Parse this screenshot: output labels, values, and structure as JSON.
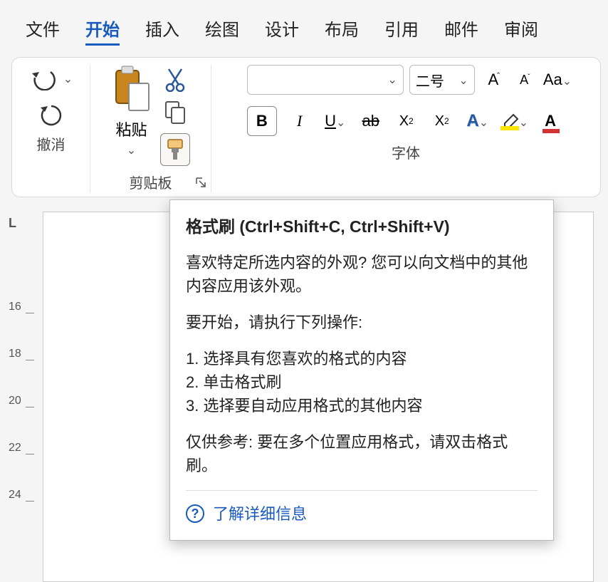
{
  "tabs": {
    "file": "文件",
    "home": "开始",
    "insert": "插入",
    "draw": "绘图",
    "design": "设计",
    "layout": "布局",
    "references": "引用",
    "mailings": "邮件",
    "review": "审阅"
  },
  "ribbon": {
    "undo_group": "撤消",
    "clipboard_group": "剪贴板",
    "font_group": "字体",
    "paste_label": "粘贴",
    "font_size_value": "二号"
  },
  "ruler": {
    "corner": "L",
    "marks": [
      "16",
      "18",
      "20",
      "22",
      "24"
    ]
  },
  "tooltip": {
    "title": "格式刷 (Ctrl+Shift+C, Ctrl+Shift+V)",
    "para1": "喜欢特定所选内容的外观? 您可以向文档中的其他内容应用该外观。",
    "intro": "要开始，请执行下列操作:",
    "step1": "1. 选择具有您喜欢的格式的内容",
    "step2": "2. 单击格式刷",
    "step3": "3. 选择要自动应用格式的其他内容",
    "para2": "仅供参考: 要在多个位置应用格式，请双击格式刷。",
    "learn_more": "了解详细信息"
  }
}
